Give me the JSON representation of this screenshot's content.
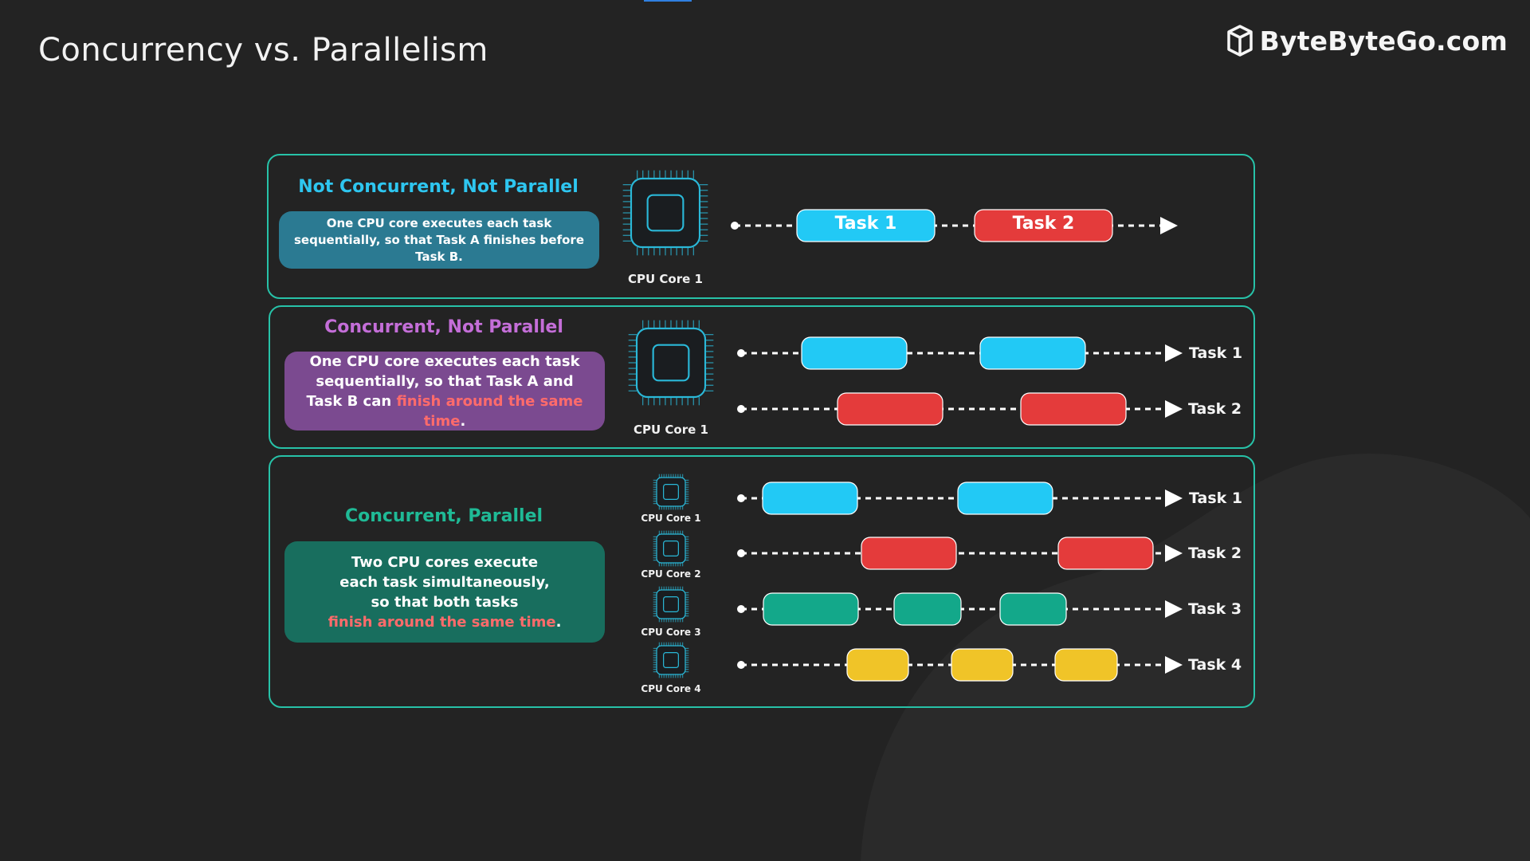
{
  "page": {
    "title": "Concurrency vs. Parallelism"
  },
  "brand": {
    "name": "ByteByteGo.com",
    "logo_icon": "book-hexagon-icon"
  },
  "colors": {
    "cyan": "#22c9f5",
    "red": "#e43b3b",
    "green": "#13a88a",
    "yellow": "#f0c428",
    "panel_border": "#27c2a8",
    "highlight": "#ff6b6b"
  },
  "panels": [
    {
      "title": "Not Concurrent, Not Parallel",
      "title_color": "#2ec6f0",
      "description": "One CPU core executes each task sequentially, so that Task A finishes before Task B.",
      "box_color": "#2b7a92",
      "cores": [
        "CPU Core 1"
      ]
    },
    {
      "title": "Concurrent, Not Parallel",
      "title_color": "#c46ed8",
      "description_prefix": "One CPU core executes each task sequentially, so that Task A and Task B can ",
      "description_highlight": "finish around the same time",
      "description_suffix": ".",
      "box_color": "#7b4a90",
      "cores": [
        "CPU Core 1"
      ],
      "tasks": [
        "Task 1",
        "Task 2"
      ]
    },
    {
      "title": "Concurrent, Parallel",
      "title_color": "#1fba96",
      "description_lines": [
        "Two CPU cores execute",
        "each task simultaneously,",
        "so that both tasks"
      ],
      "description_highlight": "finish around the same time",
      "description_suffix": ".",
      "box_color": "#186e5e",
      "cores": [
        "CPU Core 1",
        "CPU Core 2",
        "CPU Core 3",
        "CPU Core 4"
      ],
      "tasks": [
        "Task 1",
        "Task 2",
        "Task 3",
        "Task 4"
      ]
    }
  ],
  "sequential_blocks": [
    {
      "label": "Task 1",
      "color": "cyan"
    },
    {
      "label": "Task 2",
      "color": "red"
    }
  ]
}
